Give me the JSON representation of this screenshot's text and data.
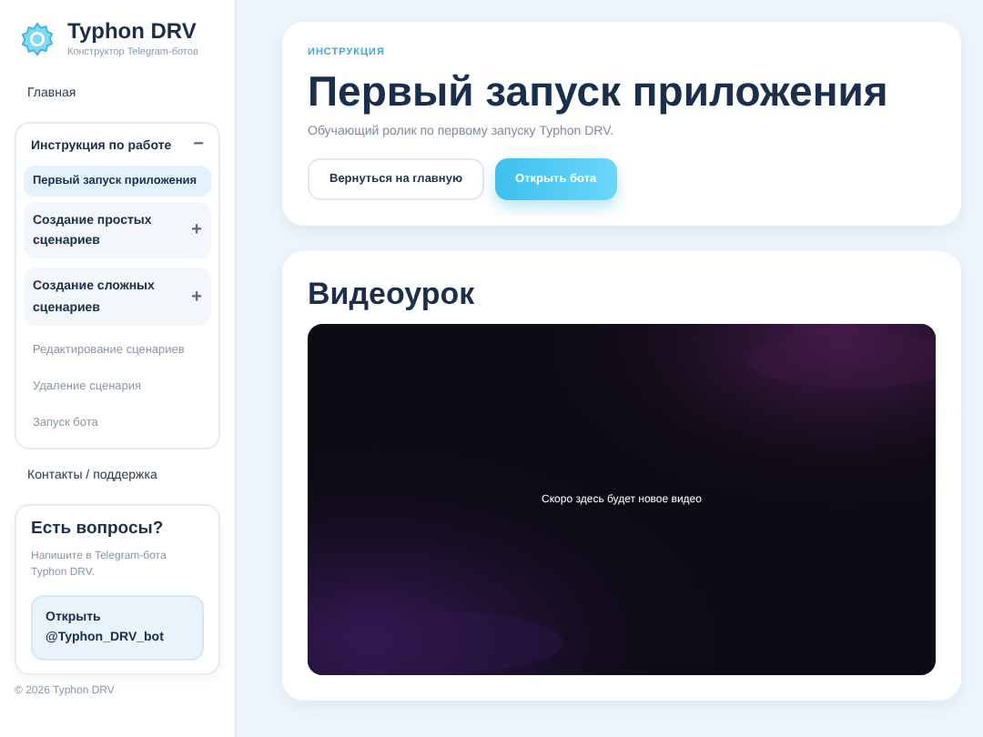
{
  "brand": {
    "title": "Typhon DRV",
    "subtitle": "Конструктор Telegram-ботов"
  },
  "sidebar": {
    "items": [
      {
        "kind": "link",
        "label": "Главная"
      },
      {
        "kind": "group",
        "label": "Инструкция по работе",
        "expanded": true,
        "toggle": "−",
        "children": [
          {
            "kind": "link",
            "label": "Первый запуск приложения",
            "selected": true
          },
          {
            "kind": "group",
            "label": "Создание простых сценариев",
            "expanded": false,
            "toggle": "+"
          },
          {
            "kind": "group",
            "label": "Создание сложных сценариев",
            "expanded": false,
            "toggle": "+"
          },
          {
            "kind": "link",
            "label": "Редактирование сценариев",
            "selected": false
          },
          {
            "kind": "link",
            "label": "Удаление сценария",
            "selected": false
          },
          {
            "kind": "link",
            "label": "Запуск бота",
            "selected": false
          }
        ]
      },
      {
        "kind": "link",
        "label": "Контакты / поддержка"
      }
    ],
    "help": {
      "title": "Есть вопросы?",
      "text": "Напишите в Telegram-бота Typhon DRV.",
      "button": "Открыть @Typhon_DRV_bot"
    },
    "footer": "© 2026 Typhon DRV"
  },
  "hero": {
    "eyebrow": "ИНСТРУКЦИЯ",
    "title": "Первый запуск приложения",
    "subtitle": "Обучающий ролик по первому запуску Typhon DRV.",
    "buttons": [
      {
        "label": "Вернуться на главную",
        "kind": "secondary"
      },
      {
        "label": "Открыть бота",
        "kind": "primary"
      }
    ]
  },
  "video": {
    "title": "Видеоурок",
    "message": "Скоро здесь будет новое видео"
  }
}
